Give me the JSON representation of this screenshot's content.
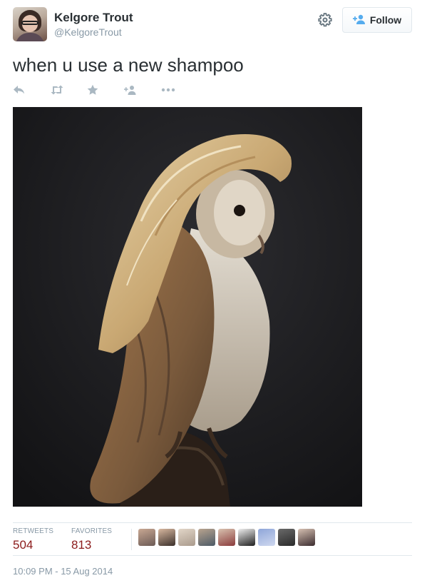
{
  "user": {
    "display_name": "Kelgore Trout",
    "handle": "@KelgoreTrout"
  },
  "header": {
    "follow_label": "Follow",
    "follow_icon": "add-user-icon",
    "settings_icon": "gear-icon"
  },
  "tweet": {
    "text": "when u use a new shampoo",
    "actions": [
      "reply-icon",
      "retweet-icon",
      "favorite-icon",
      "follow-icon",
      "more-icon"
    ]
  },
  "stats": {
    "retweets_label": "RETWEETS",
    "retweets_count": "504",
    "favorites_label": "FAVORITES",
    "favorites_count": "813"
  },
  "favorited_by_count": 9,
  "timestamp": "10:09 PM - 15 Aug 2014",
  "colors": {
    "link_blue": "#55acee",
    "stat_value": "#8b1a1a",
    "muted": "#8899a6"
  }
}
